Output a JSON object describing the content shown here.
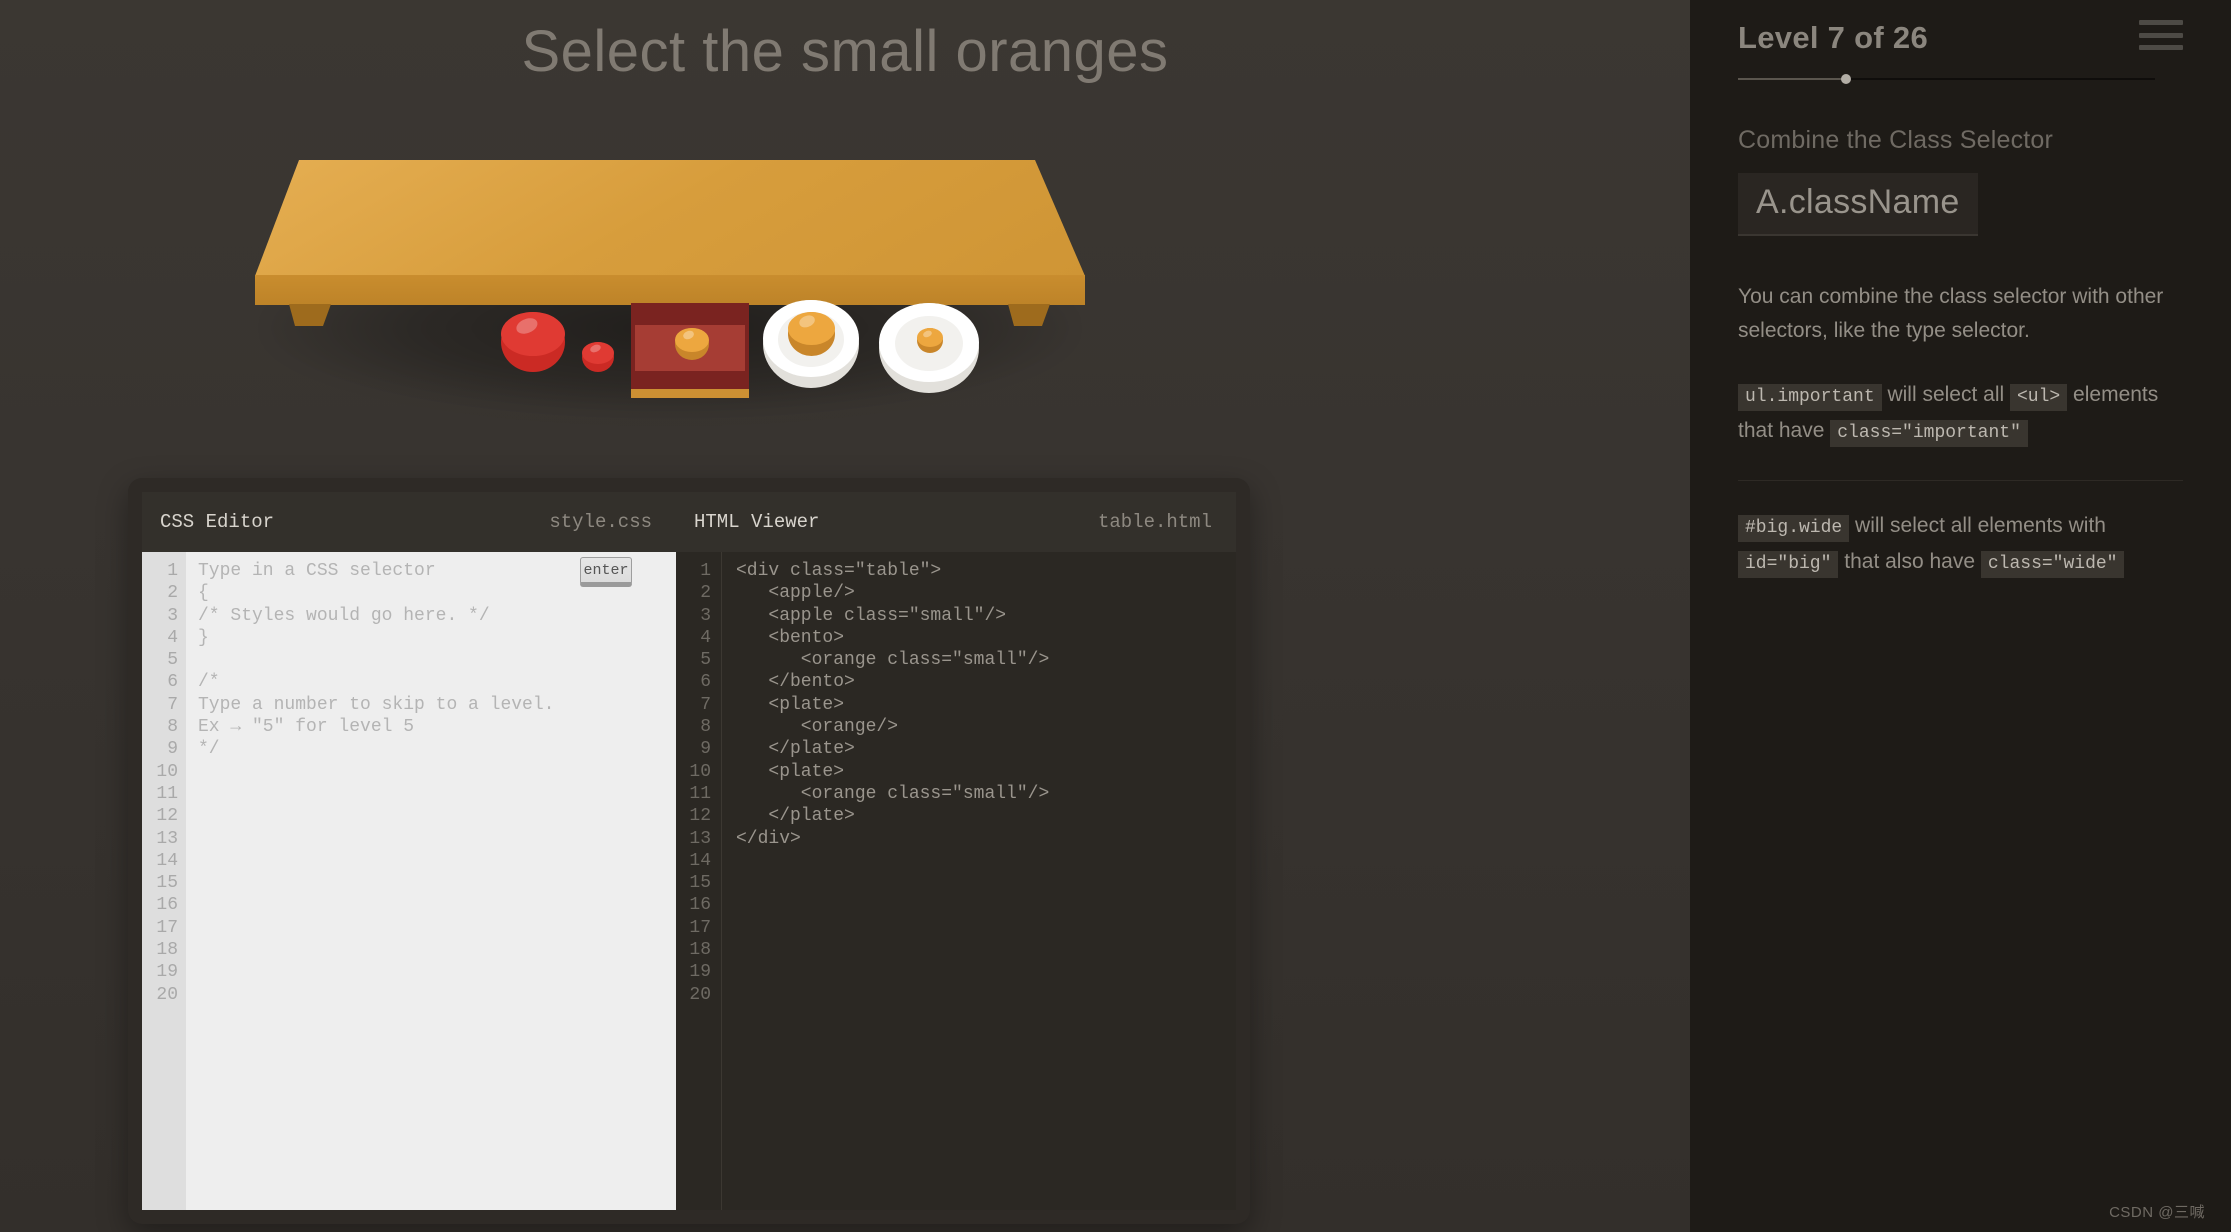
{
  "main": {
    "level_title": "Select the small oranges"
  },
  "scene": {
    "items": [
      {
        "name": "apple",
        "size": "big",
        "class": ""
      },
      {
        "name": "apple",
        "size": "small",
        "class": "small"
      },
      {
        "name": "bento",
        "size": "normal",
        "class": ""
      },
      {
        "name": "orange",
        "size": "small",
        "class": "small",
        "parent": "bento"
      },
      {
        "name": "plate",
        "size": "normal",
        "class": ""
      },
      {
        "name": "orange",
        "size": "big",
        "class": "",
        "parent": "plate"
      },
      {
        "name": "plate",
        "size": "normal",
        "class": ""
      },
      {
        "name": "orange",
        "size": "small",
        "class": "small",
        "parent": "plate"
      }
    ]
  },
  "css_editor": {
    "title": "CSS Editor",
    "filename": "style.css",
    "input_placeholder": "Type in a CSS selector",
    "input_value": "",
    "enter_label": "enter",
    "lines": [
      "Type in a CSS selector",
      "{",
      "/* Styles would go here. */",
      "}",
      "",
      "/*",
      "Type a number to skip to a level.",
      "Ex → \"5\" for level 5",
      "*/",
      "",
      "",
      "",
      "",
      "",
      "",
      "",
      "",
      "",
      "",
      ""
    ],
    "line_numbers": [
      1,
      2,
      3,
      4,
      5,
      6,
      7,
      8,
      9,
      10,
      11,
      12,
      13,
      14,
      15,
      16,
      17,
      18,
      19,
      20
    ]
  },
  "html_viewer": {
    "title": "HTML Viewer",
    "filename": "table.html",
    "lines": [
      "<div class=\"table\">",
      "   <apple/>",
      "   <apple class=\"small\"/>",
      "   <bento>",
      "      <orange class=\"small\"/>",
      "   </bento>",
      "   <plate>",
      "      <orange/>",
      "   </plate>",
      "   <plate>",
      "      <orange class=\"small\"/>",
      "   </plate>",
      "</div>",
      "",
      "",
      "",
      "",
      "",
      "",
      ""
    ],
    "line_numbers": [
      1,
      2,
      3,
      4,
      5,
      6,
      7,
      8,
      9,
      10,
      11,
      12,
      13,
      14,
      15,
      16,
      17,
      18,
      19,
      20
    ]
  },
  "sidebar": {
    "level_counter": "Level 7 of 26",
    "progress_percent": 26,
    "selector_name": "Combine the Class Selector",
    "selector_syntax": "A.className",
    "help": {
      "paragraph_1": "You can combine the class selector with other selectors, like the type selector.",
      "p2_code_1": "ul.important",
      "p2_text_1": " will select all ",
      "p2_code_2": "<ul>",
      "p2_text_2": " elements that have ",
      "p2_code_3": "class=\"important\"",
      "p3_code_1": "#big.wide",
      "p3_text_1": " will select all elements with ",
      "p3_code_2": "id=\"big\"",
      "p3_text_2": " that also have ",
      "p3_code_3": "class=\"wide\""
    },
    "menu_icon": "hamburger-menu-icon"
  },
  "watermark": "CSDN @三喊",
  "colors": {
    "background": "#383430",
    "sidebar_bg": "#1e1b17",
    "table_top": "#d79d3c",
    "table_edge": "#bb8127",
    "apple": "#e03a33",
    "orange": "#eda73f",
    "bento": "#7a2320",
    "plate": "#ffffff",
    "input_highlight": "#cde3f1"
  }
}
